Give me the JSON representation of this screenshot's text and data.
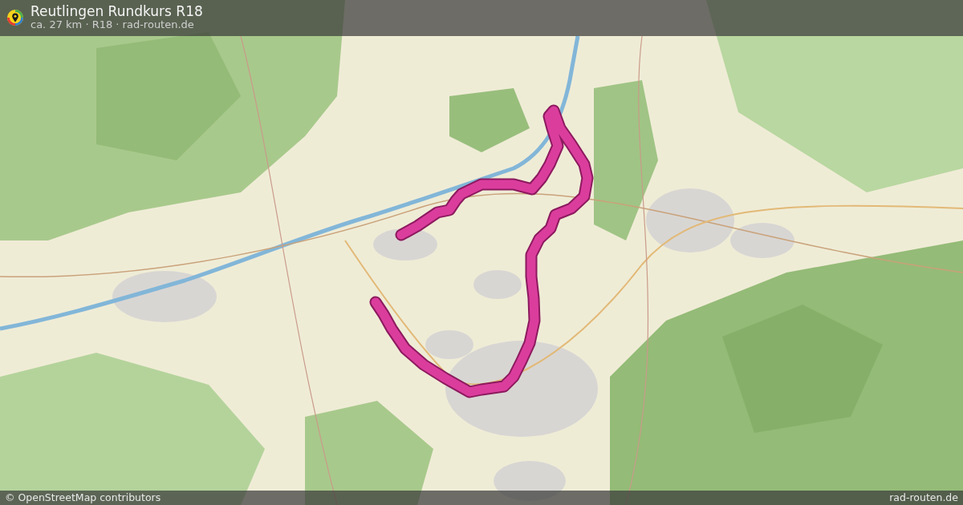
{
  "header": {
    "title": "Reutlingen Rundkurs R18",
    "subtitle": "ca. 27 km · R18 · rad-routen.de"
  },
  "footer": {
    "attribution": "© OpenStreetMap contributors",
    "brand": "rad-routen.de"
  }
}
